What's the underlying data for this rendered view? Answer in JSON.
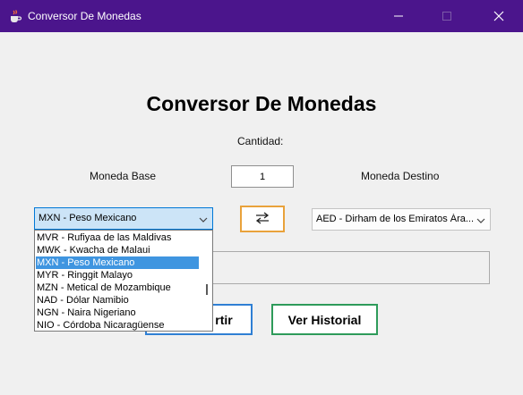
{
  "window": {
    "title": "Conversor De Monedas",
    "icon": "java-cup-icon",
    "controls": [
      "minimize-icon",
      "maximize-icon",
      "close-icon"
    ],
    "titlebar_color": "#4b158c"
  },
  "main": {
    "heading": "Conversor De Monedas",
    "amount_label": "Cantidad:",
    "base_label": "Moneda Base",
    "dest_label": "Moneda Destino",
    "amount_value": "1",
    "base_selected": "MXN - Peso Mexicano",
    "dest_selected": "AED - Dirham de los Emiratos Ára...",
    "swap_icon": "swap-arrows-icon",
    "convert_label_visible": "rtir",
    "history_label": "Ver Historial"
  },
  "dropdown": {
    "items": [
      {
        "label": "MVR - Rufiyaa de las Maldivas",
        "selected": false
      },
      {
        "label": "MWK - Kwacha de Malaui",
        "selected": false
      },
      {
        "label": "MXN - Peso Mexicano",
        "selected": true
      },
      {
        "label": "MYR - Ringgit Malayo",
        "selected": false
      },
      {
        "label": "MZN - Metical de Mozambique",
        "selected": false
      },
      {
        "label": "NAD - Dólar Namibio",
        "selected": false
      },
      {
        "label": "NGN - Naira Nigeriano",
        "selected": false
      },
      {
        "label": "NIO - Córdoba Nicaragüense",
        "selected": false
      }
    ]
  },
  "colors": {
    "accent_selection": "#3f95e0",
    "swap_border": "#e9a23b",
    "convert_border": "#2f7fd4",
    "history_border": "#2e9b5a"
  }
}
